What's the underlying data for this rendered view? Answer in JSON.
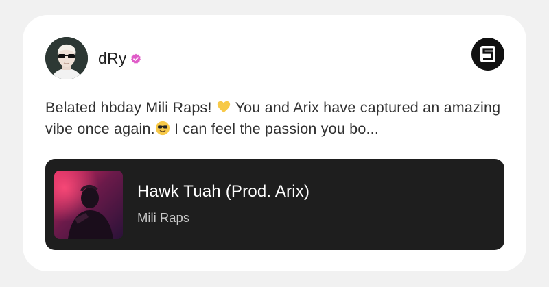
{
  "post": {
    "author": {
      "username": "dRy",
      "verified": true
    },
    "text_part1": "Belated hbday Mili Raps! ",
    "text_part2": " You and Arix have captured an amazing vibe once again.",
    "text_part3": " I can feel the passion you bo...",
    "emoji1": "yellow-heart",
    "emoji2": "sunglasses-face"
  },
  "track": {
    "title": "Hawk Tuah (Prod. Arix)",
    "artist": "Mili Raps"
  },
  "brand": {
    "logo": "s-logo-icon"
  },
  "colors": {
    "page_bg": "#f1f1f1",
    "card_bg": "#ffffff",
    "track_bg": "#1e1e1e",
    "verified": "#e05cc8"
  }
}
